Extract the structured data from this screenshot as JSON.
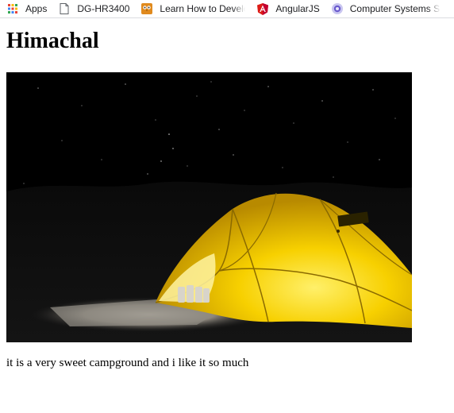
{
  "bookmarks": {
    "apps": {
      "label": "Apps",
      "icon": "apps-grid-icon"
    },
    "items": [
      {
        "label": "DG-HR3400",
        "icon": "page-icon"
      },
      {
        "label": "Learn How to Develop",
        "icon": "owl-icon"
      },
      {
        "label": "AngularJS",
        "icon": "angular-icon"
      },
      {
        "label": "Computer Systems Se",
        "icon": "circle-logo-icon"
      },
      {
        "label": "",
        "icon": "red-logo-icon"
      }
    ]
  },
  "page": {
    "heading": "Himachal",
    "image_alt": "tent",
    "caption": "it is a very sweet campground and i like it so much"
  },
  "colors": {
    "tent_yellow": "#f5c800",
    "night_sky": "#000000",
    "angular_red": "#dd1b16"
  }
}
